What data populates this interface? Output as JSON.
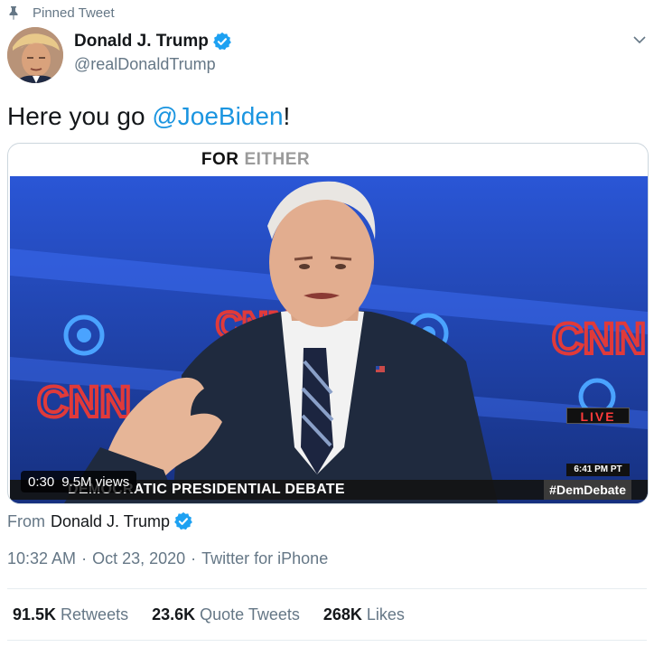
{
  "pinned": {
    "label": "Pinned Tweet",
    "icon": "pin-icon"
  },
  "author": {
    "name": "Donald J. Trump",
    "handle": "@realDonaldTrump",
    "verified_icon": "verified-badge-icon",
    "avatar_icon": "profile-avatar"
  },
  "menu": {
    "icon": "chevron-down-icon"
  },
  "tweet": {
    "text_before": "Here you go ",
    "mention": "@JoeBiden",
    "text_after": "!"
  },
  "media": {
    "title_bold": "FOR",
    "title_light": "EITHER",
    "live_label": "LIVE",
    "live_time": "6:41 PM PT",
    "lower_third": "DEMOCRATIC PRESIDENTIAL DEBATE",
    "hashtag": "#DemDebate",
    "duration": "0:30",
    "views": "9.5M views",
    "logo_text": "CNN"
  },
  "from": {
    "prefix": "From",
    "name": "Donald J. Trump"
  },
  "meta": {
    "time": "10:32 AM",
    "date": "Oct 23, 2020",
    "separator": "·",
    "source": "Twitter for iPhone"
  },
  "stats": [
    {
      "value": "91.5K",
      "label": "Retweets"
    },
    {
      "value": "23.6K",
      "label": "Quote Tweets"
    },
    {
      "value": "268K",
      "label": "Likes"
    }
  ],
  "colors": {
    "link": "#1b95e0",
    "verified": "#1da1f2",
    "muted": "#657786",
    "video_bg": "#1d3fa8",
    "cnn_red": "#e03a3a"
  }
}
